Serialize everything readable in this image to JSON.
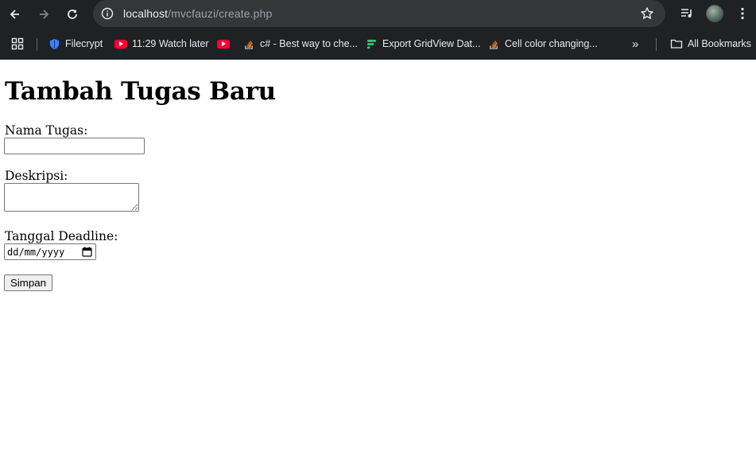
{
  "browser": {
    "url_host": "localhost",
    "url_path": "/mvcfauzi/create.php",
    "bookmarks": [
      {
        "label": "Filecrypt",
        "icon": "shield-icon"
      },
      {
        "label": "11:29 Watch later",
        "icon": "youtube-icon"
      },
      {
        "label": "",
        "icon": "youtube-icon"
      },
      {
        "label": "c# - Best way to che...",
        "icon": "stackoverflow-icon"
      },
      {
        "label": "Export GridView Dat...",
        "icon": "stack-bars-icon"
      },
      {
        "label": "Cell color changing...",
        "icon": "stackoverflow-icon"
      }
    ],
    "all_bookmarks_label": "All Bookmarks",
    "overflow_glyph": "»"
  },
  "page": {
    "title": "Tambah Tugas Baru",
    "fields": {
      "name_label": "Nama Tugas:",
      "name_value": "",
      "description_label": "Deskripsi:",
      "description_value": "",
      "deadline_label": "Tanggal Deadline:",
      "deadline_placeholder": "dd/mm/yyyy"
    },
    "submit_label": "Simpan"
  },
  "colors": {
    "chrome_bg": "#202124",
    "omnibox_bg": "#35363a",
    "youtube_red": "#ff0033",
    "filecrypt_blue": "#3b82f6",
    "stackoverflow_orange": "#f48024",
    "gridview_green": "#2ecc71"
  }
}
